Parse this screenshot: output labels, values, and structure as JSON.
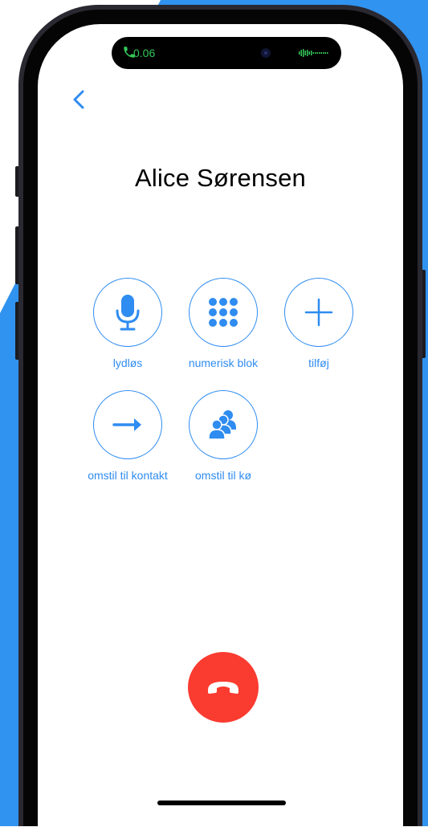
{
  "call": {
    "timer": "0.06",
    "caller_name": "Alice Sørensen"
  },
  "actions": [
    {
      "label": "lydløs",
      "icon": "microphone-icon"
    },
    {
      "label": "numerisk blok",
      "icon": "keypad-icon"
    },
    {
      "label": "tilføj",
      "icon": "plus-icon"
    },
    {
      "label": "omstil til kontakt",
      "icon": "arrow-right-icon"
    },
    {
      "label": "omstil til kø",
      "icon": "people-icon"
    }
  ],
  "colors": {
    "accent": "#2f8cf0",
    "background_blue": "#3193f0",
    "hangup_red": "#fa3b30",
    "timer_green": "#34c759"
  }
}
